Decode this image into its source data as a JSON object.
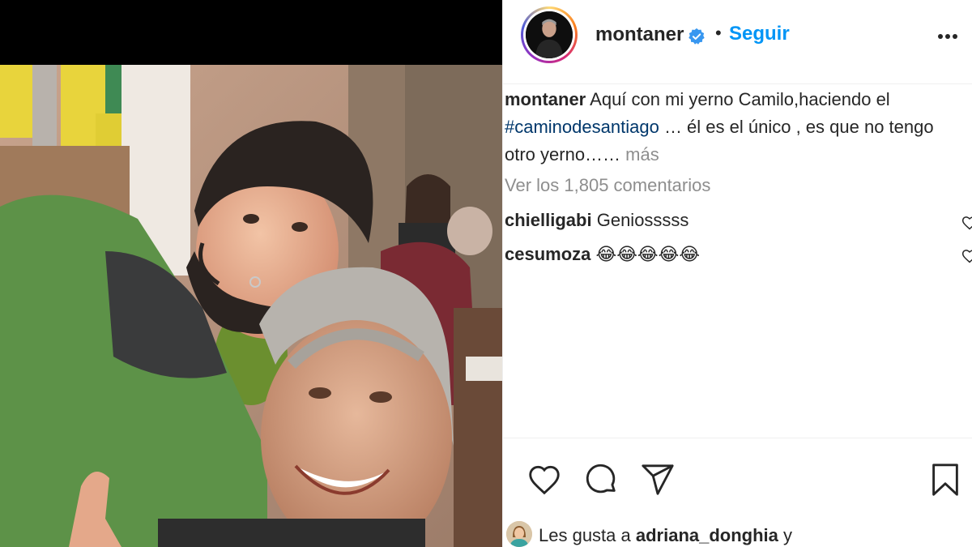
{
  "post": {
    "username": "montaner",
    "follow_label": "Seguir",
    "separator": "•",
    "caption": {
      "username": "montaner",
      "text_part1": "Aquí con mi yerno Camilo,haciendo el",
      "hashtag": "#caminodesantiago",
      "text_part2": "… él es el único , es que no tengo",
      "text_part3": "otro yerno…… ",
      "more_label": "más"
    },
    "view_comments_label": "Ver los 1,805 comentarios",
    "comments": [
      {
        "username": "chielligabi",
        "text": "Geniosssss"
      },
      {
        "username": "cesumoza",
        "text": "😂😂😂😂😂"
      }
    ],
    "likes": {
      "prefix": "Les gusta a",
      "username": "adriana_donghia",
      "suffix": "y"
    }
  },
  "icons": {
    "verified": "verified-badge-icon",
    "more": "more-options-icon",
    "like": "heart-icon",
    "comment": "comment-bubble-icon",
    "share": "paper-plane-icon",
    "save": "bookmark-icon"
  },
  "colors": {
    "link_blue": "#0095f6",
    "hashtag": "#00376b",
    "muted": "#8e8e8e",
    "text": "#262626"
  }
}
